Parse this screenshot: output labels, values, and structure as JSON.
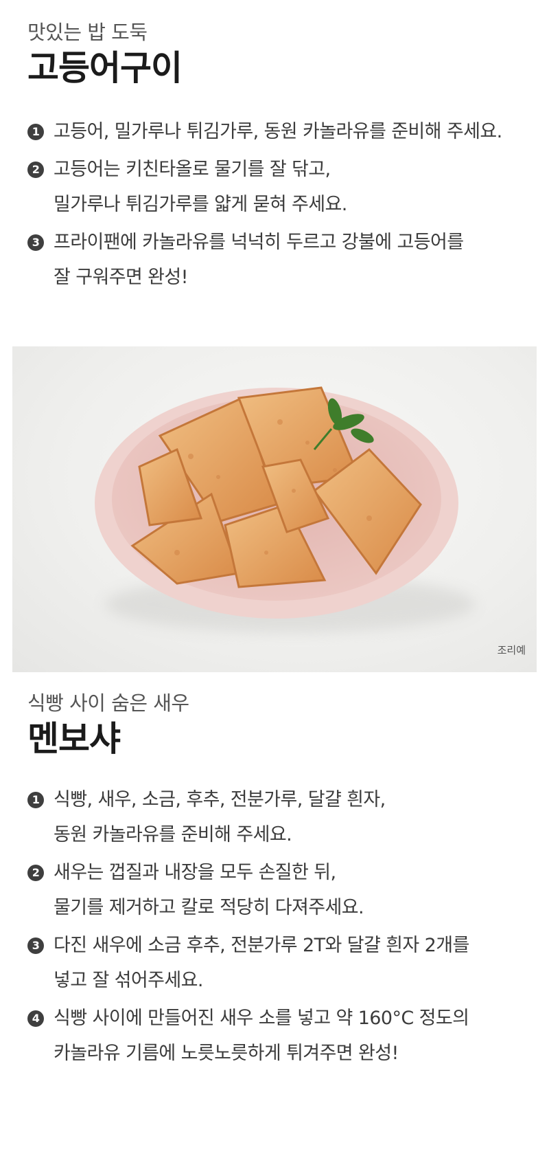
{
  "section1": {
    "subtitle": "맛있는 밥 도둑",
    "title": "고등어구이",
    "steps": [
      {
        "num": "1",
        "lines": [
          "고등어, 밀가루나 튀김가루, 동원 카놀라유를 준비해 주세요."
        ]
      },
      {
        "num": "2",
        "lines": [
          "고등어는 키친타올로 물기를 잘 닦고,",
          "밀가루나 튀김가루를 얇게 묻혀 주세요."
        ]
      },
      {
        "num": "3",
        "lines": [
          "프라이팬에 카놀라유를 넉넉히 두르고 강불에 고등어를",
          "잘 구워주면 완성!"
        ]
      }
    ]
  },
  "photo": {
    "caption": "조리예",
    "colors": {
      "bowl": "#e9c4c0",
      "bowl_inner": "#e3b8b3",
      "toast": "#e7a968",
      "toast_edge": "#c97a3b",
      "parsley": "#3f7d2b"
    }
  },
  "section2": {
    "subtitle": "식빵 사이 숨은 새우",
    "title": "멘보샤",
    "steps": [
      {
        "num": "1",
        "lines": [
          "식빵, 새우, 소금, 후추, 전분가루, 달걀 흰자,",
          "동원 카놀라유를 준비해 주세요."
        ]
      },
      {
        "num": "2",
        "lines": [
          "새우는 껍질과 내장을 모두 손질한 뒤,",
          "물기를 제거하고 칼로 적당히 다져주세요."
        ]
      },
      {
        "num": "3",
        "lines": [
          "다진 새우에 소금 후추, 전분가루 2T와 달걀 흰자 2개를",
          "넣고 잘 섞어주세요."
        ]
      },
      {
        "num": "4",
        "lines": [
          "식빵 사이에 만들어진 새우 소를 넣고 약 160°C 정도의",
          "카놀라유 기름에 노릇노릇하게 튀겨주면 완성!"
        ]
      }
    ]
  }
}
